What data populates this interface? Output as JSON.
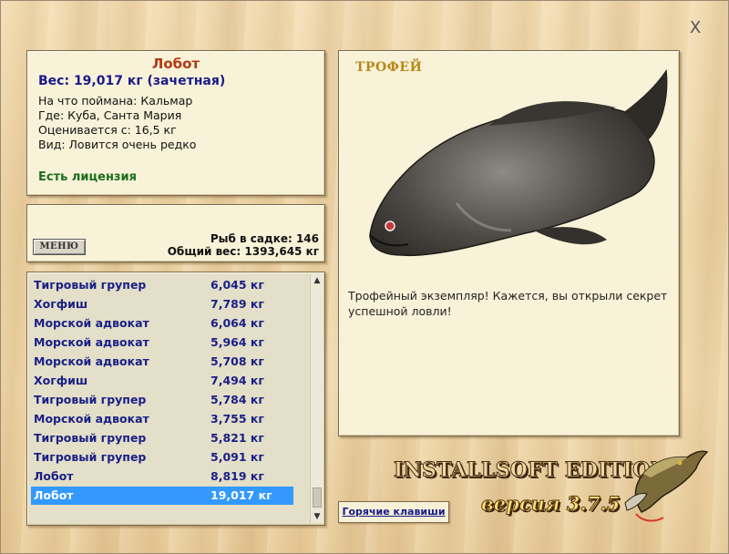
{
  "window": {
    "close_label": "X"
  },
  "info": {
    "fish_name": "Лобот",
    "weight": "Вес: 19,017 кг (зачетная)",
    "bait": "На что поймана: Кальмар",
    "location": "Где: Куба, Санта Мария",
    "rating": "Оценивается с: 16,5 кг",
    "rarity": "Вид: Ловится очень редко",
    "license": "Есть лицензия"
  },
  "stats": {
    "menu_label": "МЕНЮ",
    "count": "Рыб в садке: 146",
    "total_weight": "Общий вес: 1393,645 кг"
  },
  "catch_list": [
    {
      "name": "Тигровый групер",
      "weight": "6,045 кг"
    },
    {
      "name": "Хогфиш",
      "weight": "7,789 кг"
    },
    {
      "name": "Морской адвокат",
      "weight": "6,064 кг"
    },
    {
      "name": "Морской адвокат",
      "weight": "5,964 кг"
    },
    {
      "name": "Морской адвокат",
      "weight": "5,708 кг"
    },
    {
      "name": "Хогфиш",
      "weight": "7,494 кг"
    },
    {
      "name": "Тигровый групер",
      "weight": "5,784 кг"
    },
    {
      "name": "Морской адвокат",
      "weight": "3,755 кг"
    },
    {
      "name": "Тигровый групер",
      "weight": "5,821 кг"
    },
    {
      "name": "Тигровый групер",
      "weight": "5,091 кг"
    },
    {
      "name": "Лобот",
      "weight": "8,819 кг"
    },
    {
      "name": "Лобот",
      "weight": "19,017 кг"
    }
  ],
  "selected_index": 11,
  "trophy": {
    "label": "ТРОФЕЙ",
    "text": "Трофейный экземпляр! Кажется, вы открыли секрет успешной ловли!"
  },
  "footer": {
    "hotkeys_label": "Горячие клавиши",
    "brand": "INSTALLSOFT EDITION",
    "version": "версия 3.7.5"
  },
  "colors": {
    "accent_red": "#b23a14",
    "weight_blue": "#1a1a8a",
    "license_green": "#1b6d1b",
    "selection": "#3399ff"
  },
  "icons": [
    "close-icon",
    "scroll-up-icon",
    "scroll-down-icon",
    "fish-trophy-image",
    "pike-logo-icon"
  ]
}
